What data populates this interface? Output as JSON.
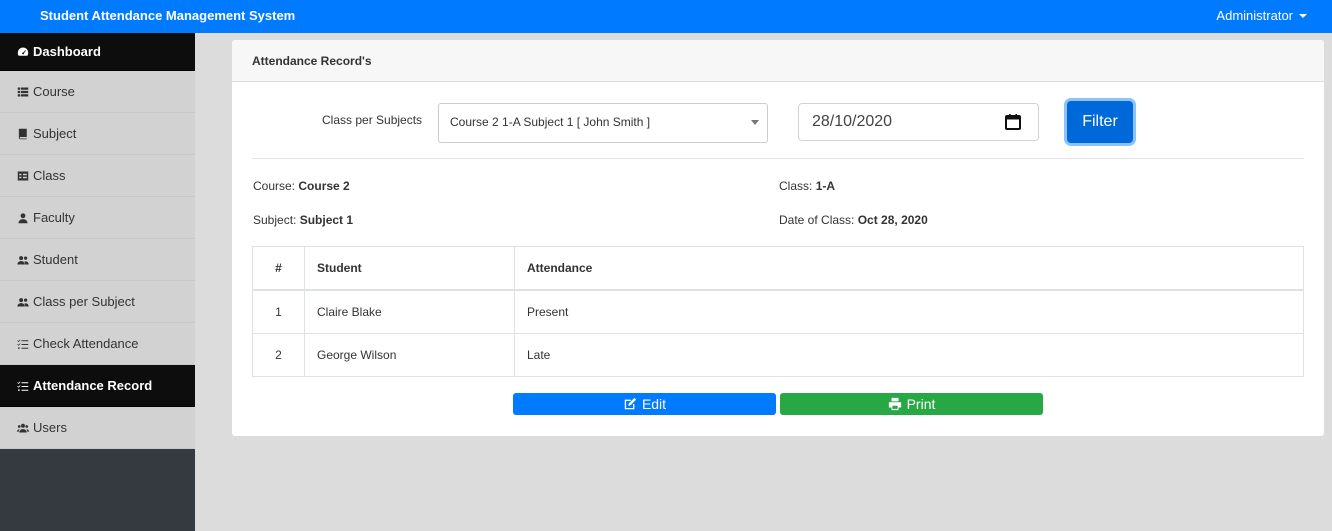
{
  "app": {
    "title": "Student Attendance Management System",
    "user": "Administrator"
  },
  "sidebar": {
    "items": [
      {
        "label": "Dashboard",
        "icon": "dashboard-icon",
        "active": false
      },
      {
        "label": "Course",
        "icon": "list-icon",
        "active": false
      },
      {
        "label": "Subject",
        "icon": "book-icon",
        "active": false
      },
      {
        "label": "Class",
        "icon": "table-icon",
        "active": false
      },
      {
        "label": "Faculty",
        "icon": "user-icon",
        "active": false
      },
      {
        "label": "Student",
        "icon": "user-group-icon",
        "active": false
      },
      {
        "label": "Class per Subject",
        "icon": "user-group-icon",
        "active": false
      },
      {
        "label": "Check Attendance",
        "icon": "tasks-icon",
        "active": false
      },
      {
        "label": "Attendance Record",
        "icon": "tasks-icon",
        "active": true
      },
      {
        "label": "Users",
        "icon": "users-icon",
        "active": false
      }
    ]
  },
  "card": {
    "title": "Attendance Record's",
    "filter": {
      "label": "Class per Subjects",
      "selected": "Course 2 1-A Subject 1 [ John Smith ]",
      "date": "28/10/2020",
      "button": "Filter"
    },
    "info": {
      "course_label": "Course:",
      "course_value": "Course 2",
      "class_label": "Class:",
      "class_value": "1-A",
      "subject_label": "Subject:",
      "subject_value": "Subject 1",
      "date_label": "Date of Class:",
      "date_value": "Oct 28, 2020"
    },
    "table": {
      "headers": [
        "#",
        "Student",
        "Attendance"
      ],
      "rows": [
        [
          "1",
          "Claire Blake",
          "Present"
        ],
        [
          "2",
          "George Wilson",
          "Late"
        ]
      ]
    },
    "actions": {
      "edit": "Edit",
      "print": "Print"
    }
  },
  "colors": {
    "topbar": "#007bff",
    "active_nav": "#0d0d0d",
    "edit": "#007bff",
    "print": "#28a745"
  }
}
